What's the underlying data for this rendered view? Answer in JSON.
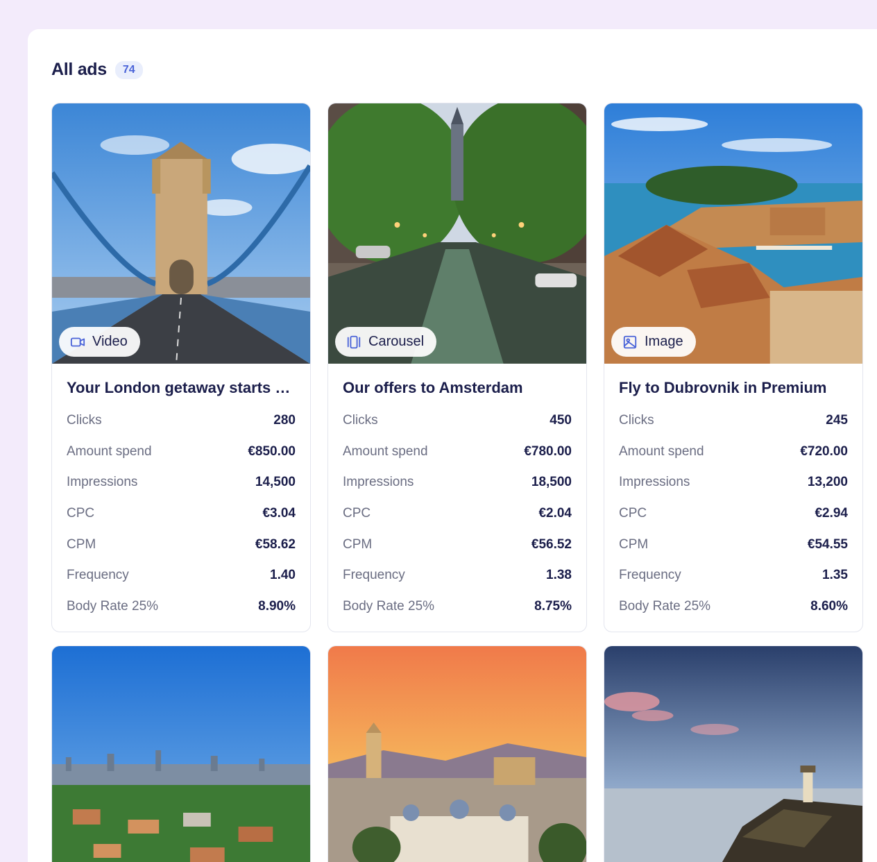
{
  "header": {
    "title": "All ads",
    "count": "74"
  },
  "ads": [
    {
      "type": "Video",
      "type_icon": "video-icon",
      "title": "Your London getaway starts here",
      "image": "Tower Bridge, London",
      "metrics": [
        {
          "label": "Clicks",
          "value": "280"
        },
        {
          "label": "Amount spend",
          "value": "€850.00"
        },
        {
          "label": "Impressions",
          "value": "14,500"
        },
        {
          "label": "CPC",
          "value": "€3.04"
        },
        {
          "label": "CPM",
          "value": "€58.62"
        },
        {
          "label": "Frequency",
          "value": "1.40"
        },
        {
          "label": "Body Rate 25%",
          "value": "8.90%"
        }
      ]
    },
    {
      "type": "Carousel",
      "type_icon": "carousel-icon",
      "title": "Our offers to Amsterdam",
      "image": "Amsterdam canal at dusk",
      "metrics": [
        {
          "label": "Clicks",
          "value": "450"
        },
        {
          "label": "Amount spend",
          "value": "€780.00"
        },
        {
          "label": "Impressions",
          "value": "18,500"
        },
        {
          "label": "CPC",
          "value": "€2.04"
        },
        {
          "label": "CPM",
          "value": "€56.52"
        },
        {
          "label": "Frequency",
          "value": "1.38"
        },
        {
          "label": "Body Rate 25%",
          "value": "8.75%"
        }
      ]
    },
    {
      "type": "Image",
      "type_icon": "image-icon",
      "title": "Fly to Dubrovnik in Premium",
      "image": "Dubrovnik old town harbour",
      "metrics": [
        {
          "label": "Clicks",
          "value": "245"
        },
        {
          "label": "Amount spend",
          "value": "€720.00"
        },
        {
          "label": "Impressions",
          "value": "13,200"
        },
        {
          "label": "CPC",
          "value": "€2.94"
        },
        {
          "label": "CPM",
          "value": "€54.55"
        },
        {
          "label": "Frequency",
          "value": "1.35"
        },
        {
          "label": "Body Rate 25%",
          "value": "8.60%"
        }
      ]
    }
  ],
  "colors": {
    "background": "#f3ebfb",
    "title": "#1b1e4b",
    "badge_bg": "#e9eefc",
    "badge_text": "#4a63d8",
    "label": "#6a6d82"
  }
}
